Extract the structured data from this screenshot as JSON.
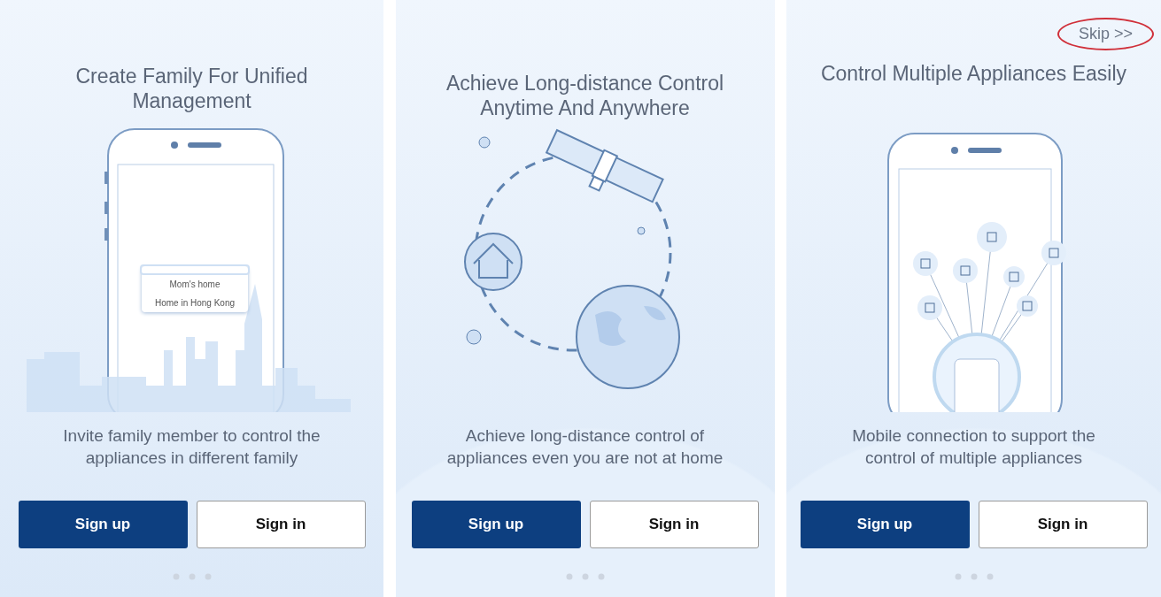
{
  "panels": [
    {
      "kind": "family",
      "title": "Create Family For Unified Management",
      "menu": [
        "Mom's home",
        "Home in Hong Kong"
      ],
      "description": "Invite family member to control the appliances in different family",
      "buttons": [
        {
          "label": "Sign up",
          "kind": "primary"
        },
        {
          "label": "Sign in",
          "kind": "secondary"
        }
      ]
    },
    {
      "kind": "satellite",
      "title": "Achieve Long-distance Control Anytime And Anywhere",
      "description": "Achieve long-distance control of appliances even you are not at home",
      "buttons": [
        {
          "label": "Sign up",
          "kind": "primary"
        },
        {
          "label": "Sign in",
          "kind": "secondary"
        }
      ]
    },
    {
      "kind": "appliances",
      "skip": {
        "label": "Skip >>",
        "highlighted": true
      },
      "title": "Control Multiple Appliances Easily",
      "description": "Mobile connection to support the control of multiple appliances",
      "buttons": [
        {
          "label": "Sign up",
          "kind": "primary"
        },
        {
          "label": "Sign in",
          "kind": "secondary"
        }
      ]
    }
  ]
}
